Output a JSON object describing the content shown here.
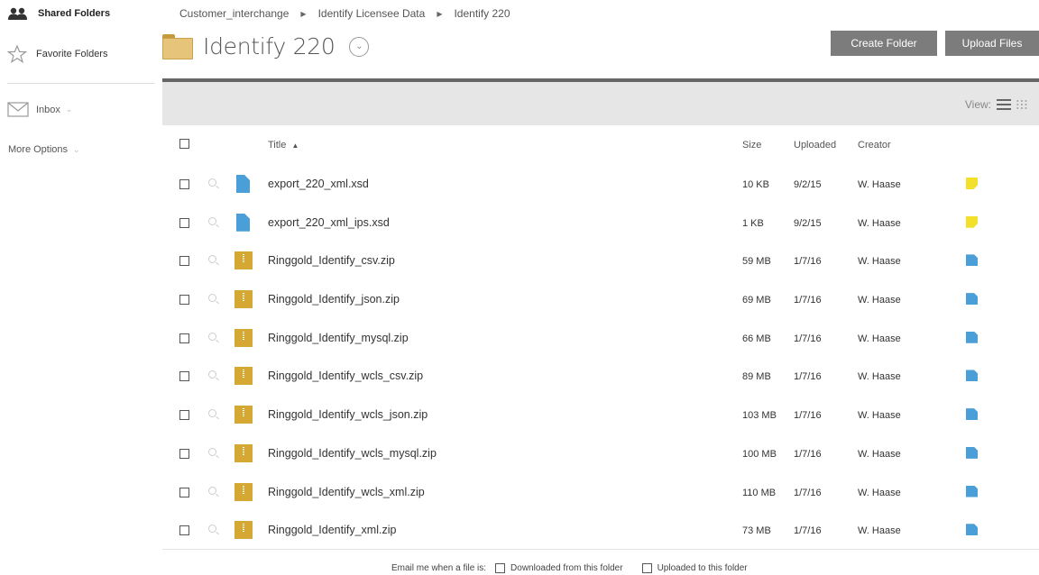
{
  "sidebar": {
    "shared_folders": "Shared Folders",
    "favorite_folders": "Favorite Folders",
    "inbox": "Inbox",
    "more_options": "More Options"
  },
  "breadcrumb": [
    "Customer_interchange",
    "Identify Licensee Data",
    "Identify 220"
  ],
  "folder": {
    "title": "Identify 220"
  },
  "buttons": {
    "create_folder": "Create Folder",
    "upload_files": "Upload Files"
  },
  "view": {
    "label": "View:"
  },
  "table": {
    "headers": {
      "title": "Title",
      "sort_indicator": "▲",
      "size": "Size",
      "uploaded": "Uploaded",
      "creator": "Creator"
    },
    "rows": [
      {
        "title": "export_220_xml.xsd",
        "size": "10 KB",
        "uploaded": "9/2/15",
        "creator": "W. Haase",
        "file_type": "xsd",
        "note": "yellow-note"
      },
      {
        "title": "export_220_xml_ips.xsd",
        "size": "1 KB",
        "uploaded": "9/2/15",
        "creator": "W. Haase",
        "file_type": "xsd",
        "note": "yellow-note"
      },
      {
        "title": "Ringgold_Identify_csv.zip",
        "size": "59 MB",
        "uploaded": "1/7/16",
        "creator": "W. Haase",
        "file_type": "zip",
        "note": "blue-note"
      },
      {
        "title": "Ringgold_Identify_json.zip",
        "size": "69 MB",
        "uploaded": "1/7/16",
        "creator": "W. Haase",
        "file_type": "zip",
        "note": "blue-note"
      },
      {
        "title": "Ringgold_Identify_mysql.zip",
        "size": "66 MB",
        "uploaded": "1/7/16",
        "creator": "W. Haase",
        "file_type": "zip",
        "note": "blue-note"
      },
      {
        "title": "Ringgold_Identify_wcls_csv.zip",
        "size": "89 MB",
        "uploaded": "1/7/16",
        "creator": "W. Haase",
        "file_type": "zip",
        "note": "blue-note"
      },
      {
        "title": "Ringgold_Identify_wcls_json.zip",
        "size": "103 MB",
        "uploaded": "1/7/16",
        "creator": "W. Haase",
        "file_type": "zip",
        "note": "blue-note"
      },
      {
        "title": "Ringgold_Identify_wcls_mysql.zip",
        "size": "100 MB",
        "uploaded": "1/7/16",
        "creator": "W. Haase",
        "file_type": "zip",
        "note": "blue-note"
      },
      {
        "title": "Ringgold_Identify_wcls_xml.zip",
        "size": "110 MB",
        "uploaded": "1/7/16",
        "creator": "W. Haase",
        "file_type": "zip",
        "note": "blue-note"
      },
      {
        "title": "Ringgold_Identify_xml.zip",
        "size": "73 MB",
        "uploaded": "1/7/16",
        "creator": "W. Haase",
        "file_type": "zip",
        "note": "blue-note"
      }
    ]
  },
  "footer": {
    "prompt": "Email me when a file is:",
    "option_downloaded": "Downloaded from this folder",
    "option_uploaded": "Uploaded to this folder"
  },
  "colors": {
    "button_bg": "#7c7c7c",
    "toolbar_bg": "#e6e6e6",
    "folder": "#e6c47a",
    "xsd_icon": "#4a9fd8",
    "zip_icon": "#d4a832",
    "note_yellow": "#f3e02a"
  }
}
